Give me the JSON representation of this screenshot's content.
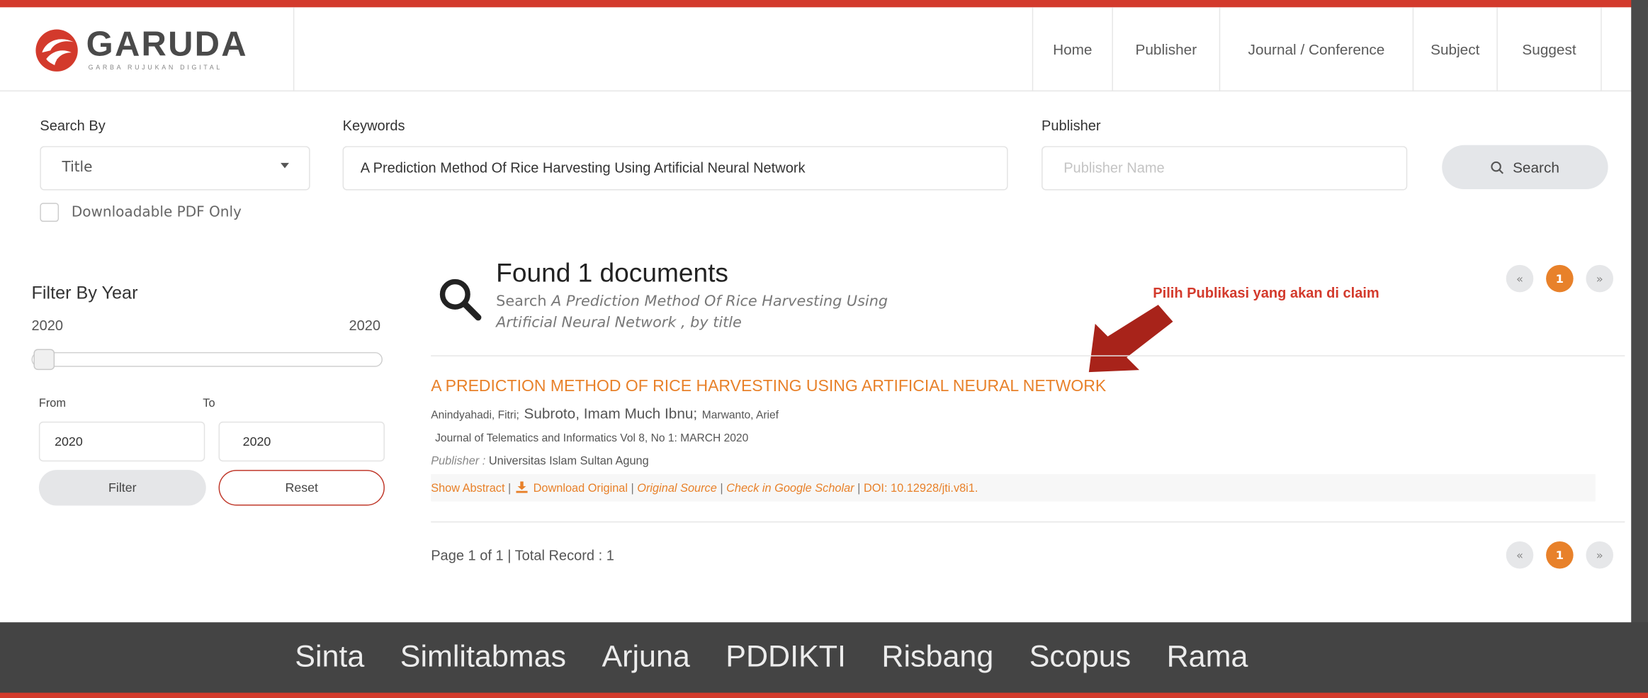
{
  "brand": {
    "name": "GARUDA",
    "tagline": "GARBA RUJUKAN DIGITAL",
    "colors": {
      "accent": "#d33a2c",
      "orange": "#e8812a",
      "dark": "#444444"
    }
  },
  "nav": {
    "items": [
      {
        "label": "Home"
      },
      {
        "label": "Publisher"
      },
      {
        "label": "Journal / Conference"
      },
      {
        "label": "Subject"
      },
      {
        "label": "Suggest"
      }
    ]
  },
  "search": {
    "search_by_label": "Search By",
    "search_by_value": "Title",
    "downloadable_label": "Downloadable PDF Only",
    "keywords_label": "Keywords",
    "keywords_value": "A Prediction Method Of Rice Harvesting Using Artificial Neural Network",
    "publisher_label": "Publisher",
    "publisher_placeholder": "Publisher Name",
    "search_button": "Search"
  },
  "filter": {
    "title": "Filter By Year",
    "range_min": "2020",
    "range_max": "2020",
    "from_label": "From",
    "to_label": "To",
    "from_value": "2020",
    "to_value": "2020",
    "filter_button": "Filter",
    "reset_button": "Reset"
  },
  "results": {
    "heading": "Found 1 documents",
    "subtitle_prefix": "Search",
    "subtitle_query": "A Prediction Method Of Rice Harvesting Using",
    "subtitle_query_2": "Artificial Neural Network , by title",
    "annotation": "Pilih Publikasi yang akan di claim",
    "items": [
      {
        "title": "A PREDICTION METHOD OF RICE HARVESTING USING ARTIFICIAL NEURAL NETWORK",
        "author_1": "Anindyahadi, Fitri;",
        "author_2": "Subroto, Imam Much Ibnu;",
        "author_3": "Marwanto, Arief",
        "journal": "Journal of Telematics and Informatics Vol 8, No 1: MARCH 2020",
        "publisher_label": "Publisher :",
        "publisher": "Universitas Islam Sultan Agung",
        "show_abstract": "Show Abstract",
        "download": "Download Original",
        "original_source": "Original Source",
        "google_scholar": "Check in Google Scholar",
        "doi": "DOI: 10.12928/jti.v8i1."
      }
    ],
    "page_info": "Page 1 of 1 | Total Record : 1",
    "pagination": {
      "prev": "«",
      "current": "1",
      "next": "»"
    }
  },
  "footer": {
    "links": [
      "Sinta",
      "Simlitabmas",
      "Arjuna",
      "PDDIKTI",
      "Risbang",
      "Scopus",
      "Rama"
    ]
  }
}
